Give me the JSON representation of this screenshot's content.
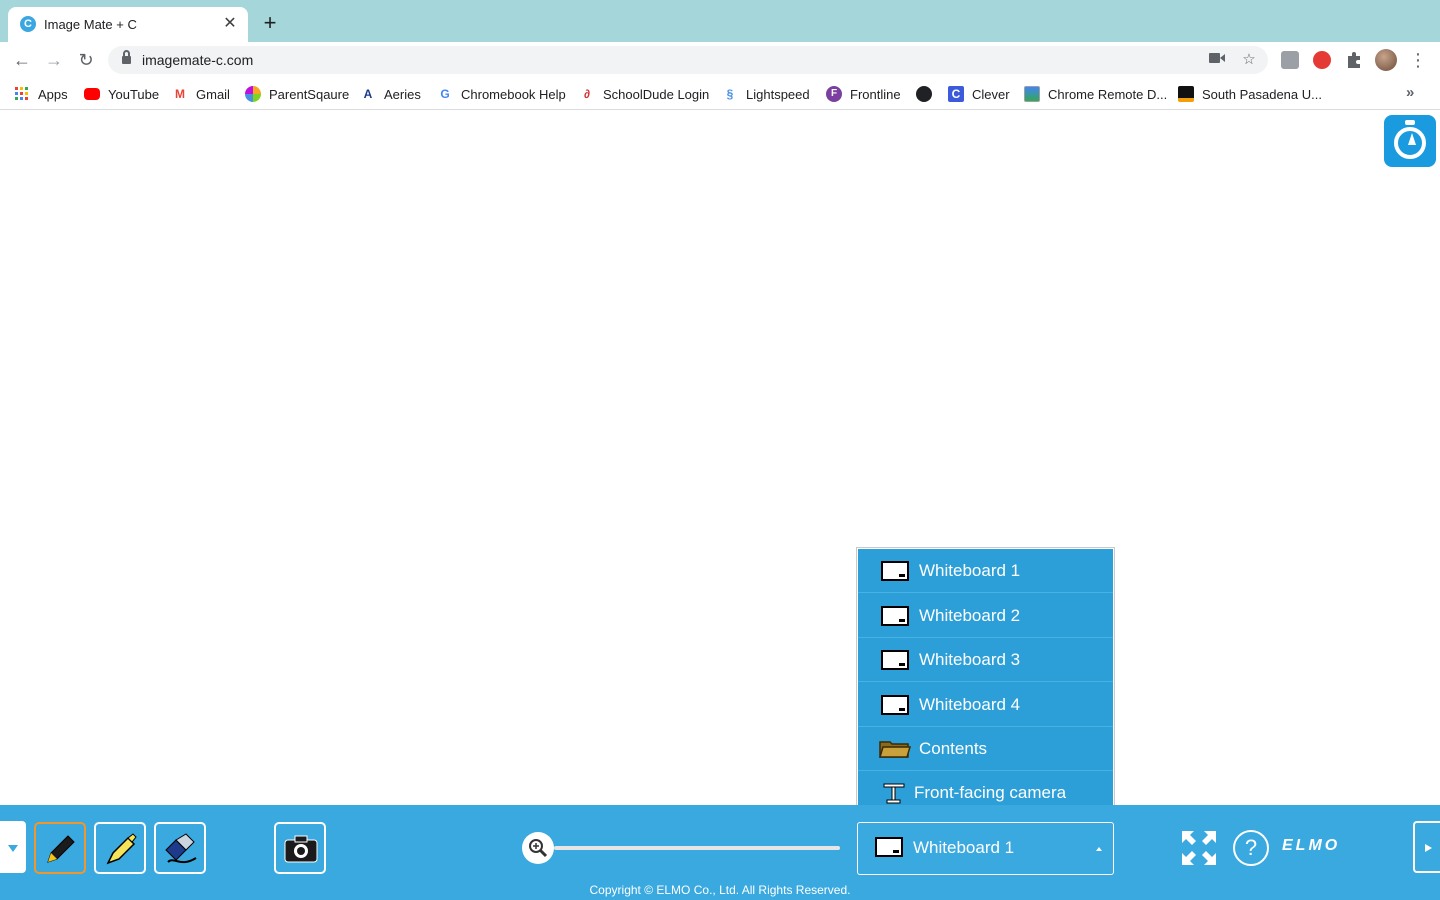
{
  "browser": {
    "tab_title": "Image Mate + C",
    "tab_close": "✕",
    "new_tab": "+",
    "url": "imagemate-c.com",
    "nav": {
      "back": "←",
      "forward": "→",
      "reload": "↻"
    },
    "menu": "⋮",
    "bookmarks_more": "»"
  },
  "bookmarks": [
    {
      "label": "Apps",
      "icon": "apps-grid-icon"
    },
    {
      "label": "YouTube",
      "icon": "youtube-icon"
    },
    {
      "label": "Gmail",
      "icon": "gmail-icon"
    },
    {
      "label": "ParentSqaure",
      "icon": "parentsquare-icon"
    },
    {
      "label": "Aeries",
      "icon": "aeries-icon"
    },
    {
      "label": "Chromebook Help",
      "icon": "google-icon"
    },
    {
      "label": "SchoolDude Login",
      "icon": "schooldude-icon"
    },
    {
      "label": "Lightspeed",
      "icon": "lightspeed-icon"
    },
    {
      "label": "Frontline",
      "icon": "frontline-icon"
    },
    {
      "label": "",
      "icon": "globe-icon"
    },
    {
      "label": "Clever",
      "icon": "clever-icon"
    },
    {
      "label": "Chrome Remote D...",
      "icon": "chrome-remote-icon"
    },
    {
      "label": "South Pasadena U...",
      "icon": "spusd-icon"
    }
  ],
  "app": {
    "source_menu": [
      {
        "label": "Whiteboard 1",
        "icon": "whiteboard-icon"
      },
      {
        "label": "Whiteboard 2",
        "icon": "whiteboard-icon"
      },
      {
        "label": "Whiteboard 3",
        "icon": "whiteboard-icon"
      },
      {
        "label": "Whiteboard 4",
        "icon": "whiteboard-icon"
      },
      {
        "label": "Contents",
        "icon": "folder-icon"
      },
      {
        "label": "Front-facing camera",
        "icon": "document-camera-icon"
      }
    ],
    "selected_source": "Whiteboard 1",
    "tools": [
      {
        "name": "pen-tool",
        "active": true
      },
      {
        "name": "highlighter-tool",
        "active": false
      },
      {
        "name": "eraser-tool",
        "active": false
      }
    ],
    "help_label": "?",
    "brand": "ELMO",
    "copyright": "Copyright © ELMO Co., Ltd. All Rights Reserved.",
    "colors": {
      "accent": "#3aa9e0",
      "menu": "#2d9fd8",
      "active_tool": "#f0962e"
    }
  }
}
